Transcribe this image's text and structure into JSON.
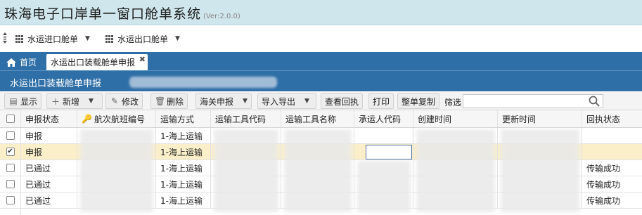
{
  "app": {
    "title": "珠海电子口岸单一窗口舱单系统",
    "version": "(Ver:2.0.0)"
  },
  "menu": {
    "items": [
      {
        "label": "水运进口舱单",
        "icon": "grid-icon"
      },
      {
        "label": "水运出口舱单",
        "icon": "grid-icon"
      }
    ]
  },
  "tabs": {
    "home": {
      "label": "首页",
      "icon": "home-icon"
    },
    "active": {
      "label": "水运出口装载舱单申报"
    }
  },
  "panel": {
    "title": "水运出口装载舱单申报"
  },
  "toolbar": {
    "buttons": [
      {
        "label": "显示",
        "icon": "table-icon"
      },
      {
        "label": "新增",
        "icon": "plus-icon"
      },
      {
        "label": "修改",
        "icon": "edit-icon"
      },
      {
        "label": "删除",
        "icon": "trash-icon"
      },
      {
        "label": "海关申报"
      },
      {
        "label": "导入导出"
      },
      {
        "label": "查看回执"
      },
      {
        "label": "打印"
      },
      {
        "label": "整单复制"
      }
    ],
    "filter_label": "筛选",
    "filter_value": ""
  },
  "table": {
    "columns": [
      "",
      "申报状态",
      "航次航班编号",
      "运输方式",
      "运输工具代码",
      "运输工具名称",
      "承运人代码",
      "创建时间",
      "更新时间",
      "回执状态"
    ],
    "rows": [
      {
        "checked": false,
        "status": "申报",
        "transport": "1-海上运输",
        "receipt": ""
      },
      {
        "checked": true,
        "status": "申报",
        "transport": "1-海上运输",
        "receipt": ""
      },
      {
        "checked": false,
        "status": "已通过",
        "transport": "1-海上运输",
        "receipt": "传输成功"
      },
      {
        "checked": false,
        "status": "已通过",
        "transport": "1-海上运输",
        "receipt": "传输成功"
      },
      {
        "checked": false,
        "status": "已通过",
        "transport": "1-海上运输",
        "receipt": "传输成功"
      }
    ]
  },
  "colors": {
    "title_bar": "#cfe6ec",
    "header_blue": "#2f6fa7",
    "selected_row": "#fbefc9"
  }
}
